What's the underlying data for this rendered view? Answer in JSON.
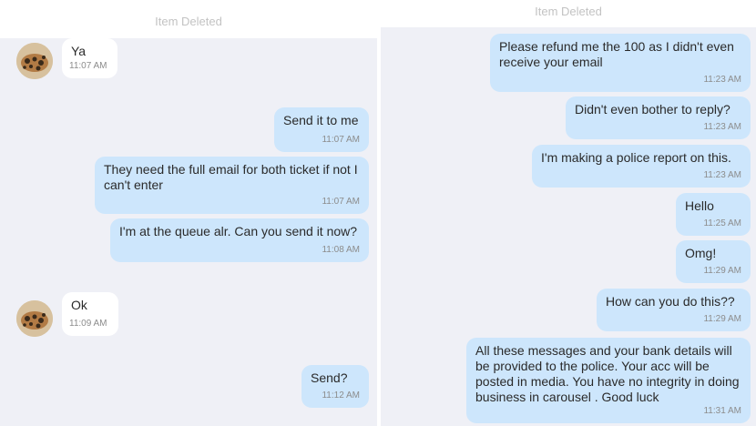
{
  "left": {
    "header": "Item Deleted",
    "messages": [
      {
        "text": "Ya",
        "time": "11:07 AM"
      },
      {
        "text": "Send it to me",
        "time": "11:07 AM"
      },
      {
        "text": "They need the full email for both ticket if not I can't enter",
        "time": "11:07 AM"
      },
      {
        "text": "I'm at the queue alr. Can you send it now?",
        "time": "11:08 AM"
      },
      {
        "text": "Ok",
        "time": "11:09 AM"
      },
      {
        "text": "Send?",
        "time": "11:12 AM"
      }
    ]
  },
  "right": {
    "header": "Item Deleted",
    "messages": [
      {
        "text": "Please refund me the 100 as I didn't even receive your email",
        "time": "11:23 AM"
      },
      {
        "text": "Didn't even bother to reply?",
        "time": "11:23 AM"
      },
      {
        "text": "I'm making a police report on this.",
        "time": "11:23 AM"
      },
      {
        "text": "Hello",
        "time": "11:25 AM"
      },
      {
        "text": "Omg!",
        "time": "11:29 AM"
      },
      {
        "text": "How can you do this??",
        "time": "11:29 AM"
      },
      {
        "text": "All these messages and your bank details will be provided to the police. Your acc will be posted in media. You have no integrity in doing business in carousel . Good luck",
        "time": "11:31 AM"
      }
    ]
  },
  "colors": {
    "outgoing_bubble": "#cde6fc",
    "incoming_bubble": "#ffffff",
    "chat_background": "#eff0f6",
    "header_text": "#c3c3c3"
  },
  "icons": {
    "avatar": "leopard-print-avatar"
  }
}
